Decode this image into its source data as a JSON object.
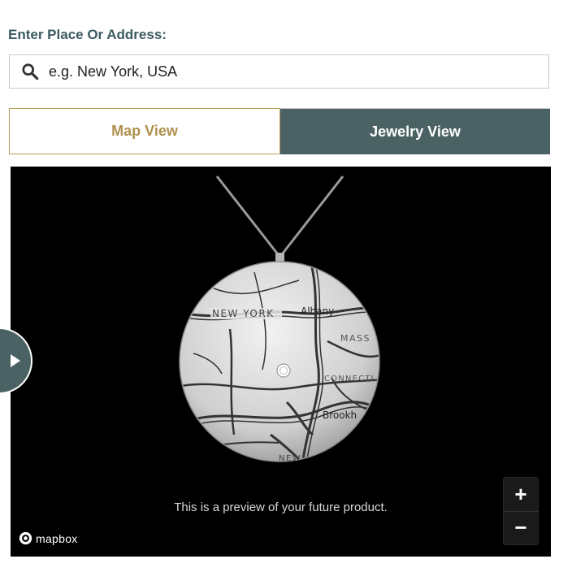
{
  "search": {
    "label": "Enter Place Or Address:",
    "placeholder": "e.g. New York, USA",
    "value": ""
  },
  "tabs": [
    {
      "label": "Map View",
      "active": false
    },
    {
      "label": "Jewelry View",
      "active": true
    }
  ],
  "preview": {
    "caption": "This is a preview of your future product.",
    "attribution": "mapbox",
    "map_labels": {
      "new_york": "NEW YORK",
      "albany": "Albany",
      "mass": "MASS",
      "connecticut": "CONNECTI",
      "brookhaven": "Brookh",
      "new": "NEW"
    }
  },
  "zoom": {
    "in_label": "+",
    "out_label": "−"
  },
  "colors": {
    "heading": "#3c5a60",
    "accent_gold": "#b0914f",
    "active_tab": "#4b6265",
    "preview_bg": "#000000"
  },
  "icons": {
    "search": "search-icon",
    "sidebar_toggle": "play-icon",
    "attribution": "mapbox-logo-icon"
  }
}
